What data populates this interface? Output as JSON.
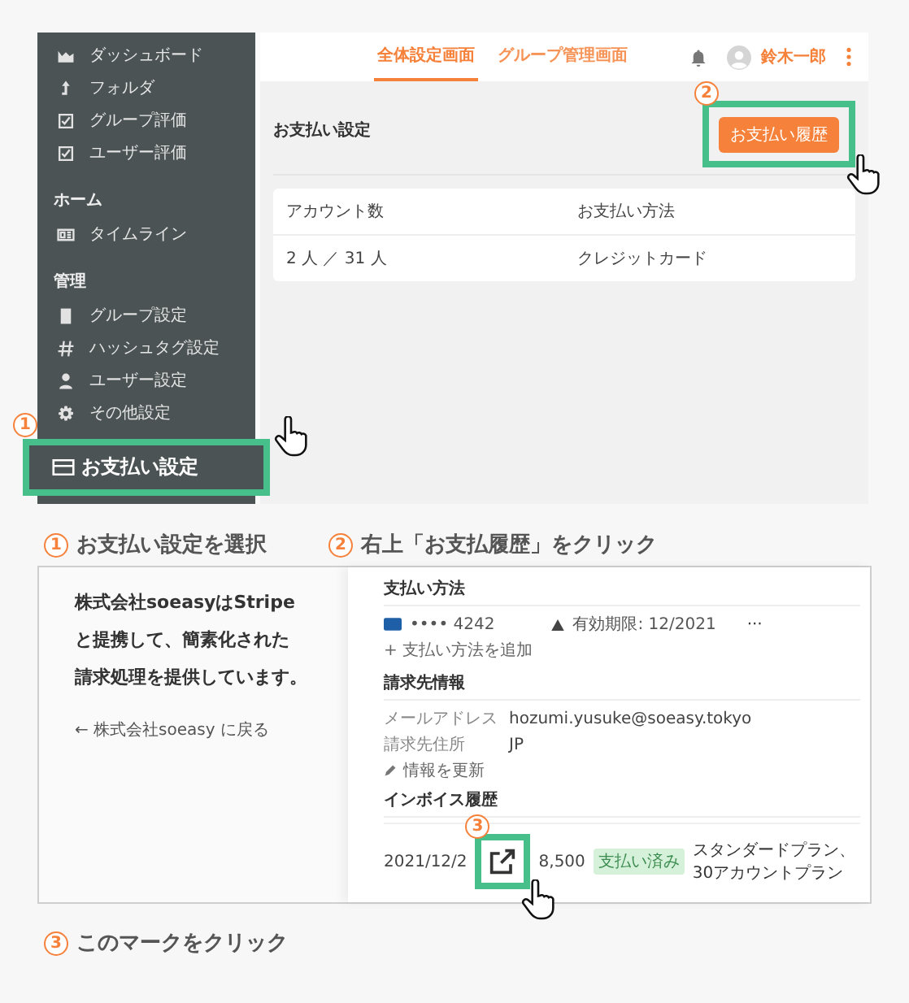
{
  "step1_screen": {
    "sidebar": {
      "groups": [
        {
          "items": [
            {
              "label": "ダッシュボード"
            },
            {
              "label": "フォルダ"
            },
            {
              "label": "グループ評価"
            },
            {
              "label": "ユーザー評価"
            }
          ]
        },
        {
          "heading": "ホーム",
          "items": [
            {
              "label": "タイムライン"
            }
          ]
        },
        {
          "heading": "管理",
          "items": [
            {
              "label": "グループ設定"
            },
            {
              "label": "ハッシュタグ設定"
            },
            {
              "label": "ユーザー設定"
            },
            {
              "label": "その他設定"
            }
          ]
        }
      ],
      "highlighted_item": {
        "label": "お支払い設定",
        "callout": "1"
      }
    },
    "tabs": [
      {
        "label": "全体設定画面",
        "selected": true
      },
      {
        "label": "グループ管理画面",
        "selected": false
      }
    ],
    "user_name": "鈴木一郎",
    "page_title": "お支払い設定",
    "history_button": {
      "label": "お支払い履歴",
      "callout": "2"
    },
    "table": {
      "columns": [
        "アカウント数",
        "お支払い方法"
      ],
      "rows": [
        [
          "2 人 ／ 31 人",
          "クレジットカード"
        ]
      ]
    }
  },
  "steps": [
    {
      "number": "1",
      "text": "お支払い設定を選択"
    },
    {
      "number": "2",
      "text": "右上「お支払履歴」をクリック"
    }
  ],
  "step3_screen": {
    "intro": [
      "株式会社soeasyはStripe",
      "と提携して、簡素化された",
      "請求処理を提供しています。"
    ],
    "back_link": "← 株式会社soeasy に戻る",
    "payment_heading": "支払い方法",
    "card": {
      "number": "•••• 4242",
      "expiry": "有効期限: 12/2021",
      "menu": "···"
    },
    "add_payment": "+ 支払い方法を追加",
    "billing_heading": "請求先情報",
    "billing": [
      {
        "label": "メールアドレス",
        "value": "hozumi.yusuke@soeasy.tokyo"
      },
      {
        "label": "請求先住所",
        "value": "JP"
      }
    ],
    "update_link": "情報を更新",
    "invoice_heading": "インボイス履歴",
    "invoices": [
      {
        "date": "2021/12/2",
        "amount": "8,500",
        "status": "支払い済み",
        "description": "スタンダードプラン、30アカウントプラン",
        "callout": "3"
      }
    ]
  },
  "step3": {
    "number": "3",
    "text": "このマークをクリック"
  }
}
